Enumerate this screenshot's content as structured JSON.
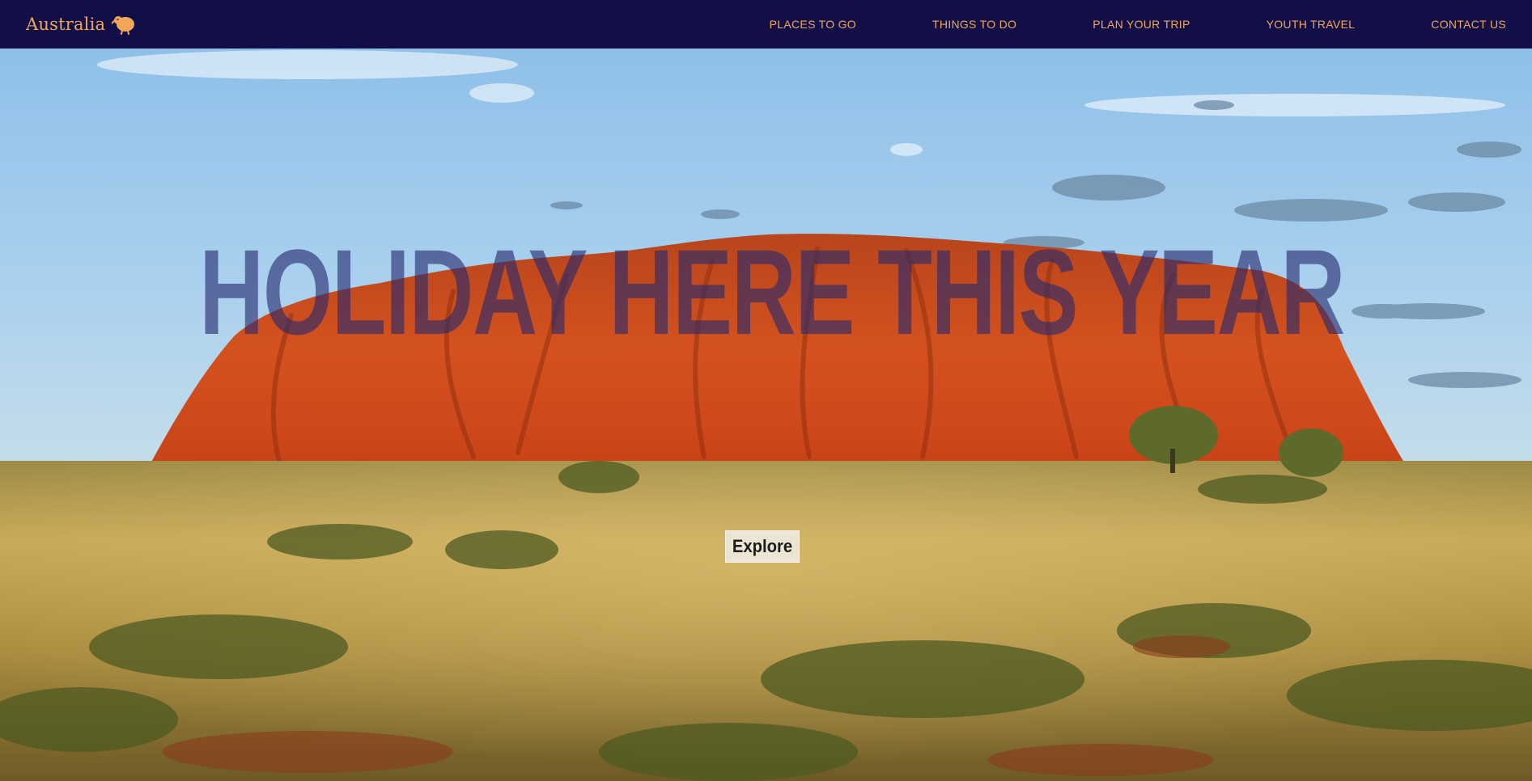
{
  "nav": {
    "brand": "Australia",
    "brand_icon": "kiwi-bird-icon",
    "links": [
      {
        "label": "PLACES TO GO"
      },
      {
        "label": "THINGS TO DO"
      },
      {
        "label": "PLAN YOUR TRIP"
      },
      {
        "label": "YOUTH TRAVEL"
      },
      {
        "label": "CONTACT US"
      }
    ]
  },
  "hero": {
    "headline": "HOLIDAY HERE THIS YEAR",
    "cta_label": "Explore"
  },
  "colors": {
    "nav_bg": "#120f48",
    "accent": "#f2a65a",
    "headline": "#262a6e"
  }
}
